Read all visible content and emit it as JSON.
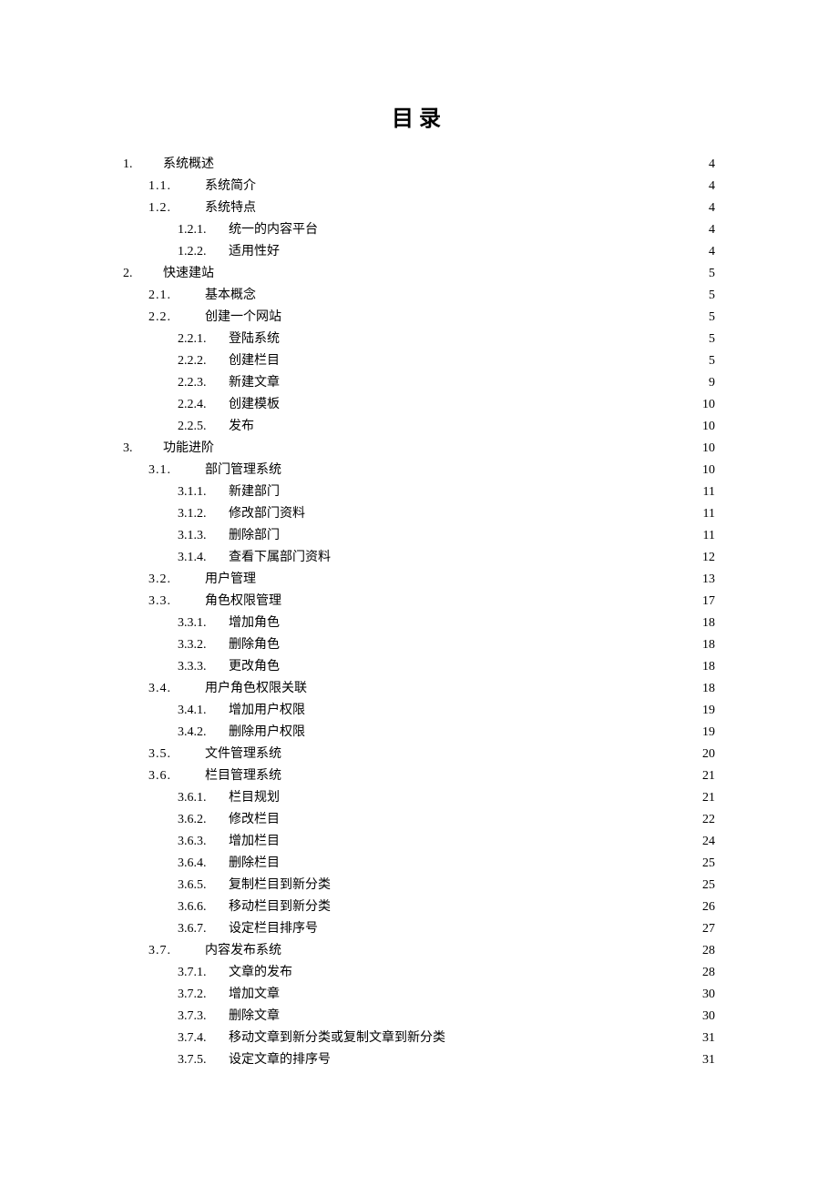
{
  "title": "目录",
  "entries": [
    {
      "level": 0,
      "num": "1.",
      "label": "系统概述",
      "page": "4"
    },
    {
      "level": 1,
      "num": "1.1.",
      "label": "系统简介",
      "page": "4"
    },
    {
      "level": 1,
      "num": "1.2.",
      "label": "系统特点",
      "page": "4"
    },
    {
      "level": 2,
      "num": "1.2.1.",
      "label": "统一的内容平台",
      "page": "4"
    },
    {
      "level": 2,
      "num": "1.2.2.",
      "label": "适用性好",
      "page": "4"
    },
    {
      "level": 0,
      "num": "2.",
      "label": "快速建站",
      "page": "5"
    },
    {
      "level": 1,
      "num": "2.1.",
      "label": "基本概念",
      "page": "5"
    },
    {
      "level": 1,
      "num": "2.2.",
      "label": "创建一个网站",
      "page": "5"
    },
    {
      "level": 2,
      "num": "2.2.1.",
      "label": "登陆系统",
      "page": "5"
    },
    {
      "level": 2,
      "num": "2.2.2.",
      "label": "创建栏目",
      "page": "5"
    },
    {
      "level": 2,
      "num": "2.2.3.",
      "label": "新建文章",
      "page": "9"
    },
    {
      "level": 2,
      "num": "2.2.4.",
      "label": "创建模板",
      "page": "10"
    },
    {
      "level": 2,
      "num": "2.2.5.",
      "label": "发布",
      "page": "10"
    },
    {
      "level": 0,
      "num": "3.",
      "label": "功能进阶",
      "page": "10"
    },
    {
      "level": 1,
      "num": "3.1.",
      "label": "部门管理系统",
      "page": "10"
    },
    {
      "level": 2,
      "num": "3.1.1.",
      "label": "新建部门",
      "page": "11"
    },
    {
      "level": 2,
      "num": "3.1.2.",
      "label": "修改部门资料",
      "page": "11"
    },
    {
      "level": 2,
      "num": "3.1.3.",
      "label": "删除部门",
      "page": "11"
    },
    {
      "level": 2,
      "num": "3.1.4.",
      "label": "查看下属部门资料",
      "page": "12"
    },
    {
      "level": 1,
      "num": "3.2.",
      "label": "用户管理",
      "page": "13"
    },
    {
      "level": 1,
      "num": "3.3.",
      "label": "角色权限管理",
      "page": "17"
    },
    {
      "level": 2,
      "num": "3.3.1.",
      "label": "增加角色",
      "page": "18"
    },
    {
      "level": 2,
      "num": "3.3.2.",
      "label": "删除角色",
      "page": "18"
    },
    {
      "level": 2,
      "num": "3.3.3.",
      "label": "更改角色",
      "page": "18"
    },
    {
      "level": 1,
      "num": "3.4.",
      "label": "用户角色权限关联",
      "page": "18"
    },
    {
      "level": 2,
      "num": "3.4.1.",
      "label": "增加用户权限",
      "page": "19"
    },
    {
      "level": 2,
      "num": "3.4.2.",
      "label": "删除用户权限",
      "page": "19"
    },
    {
      "level": 1,
      "num": "3.5.",
      "label": "文件管理系统",
      "page": "20"
    },
    {
      "level": 1,
      "num": "3.6.",
      "label": "栏目管理系统",
      "page": "21"
    },
    {
      "level": 2,
      "num": "3.6.1.",
      "label": "栏目规划",
      "page": "21"
    },
    {
      "level": 2,
      "num": "3.6.2.",
      "label": "修改栏目",
      "page": "22"
    },
    {
      "level": 2,
      "num": "3.6.3.",
      "label": "增加栏目",
      "page": "24"
    },
    {
      "level": 2,
      "num": "3.6.4.",
      "label": "删除栏目",
      "page": "25"
    },
    {
      "level": 2,
      "num": "3.6.5.",
      "label": "复制栏目到新分类",
      "page": "25"
    },
    {
      "level": 2,
      "num": "3.6.6.",
      "label": "移动栏目到新分类",
      "page": "26"
    },
    {
      "level": 2,
      "num": "3.6.7.",
      "label": "设定栏目排序号",
      "page": "27"
    },
    {
      "level": 1,
      "num": "3.7.",
      "label": "内容发布系统",
      "page": "28"
    },
    {
      "level": 2,
      "num": "3.7.1.",
      "label": "文章的发布",
      "page": "28"
    },
    {
      "level": 2,
      "num": "3.7.2.",
      "label": "增加文章",
      "page": "30"
    },
    {
      "level": 2,
      "num": "3.7.3.",
      "label": "删除文章",
      "page": "30"
    },
    {
      "level": 2,
      "num": "3.7.4.",
      "label": "移动文章到新分类或复制文章到新分类",
      "page": "31"
    },
    {
      "level": 2,
      "num": "3.7.5.",
      "label": "设定文章的排序号",
      "page": "31"
    }
  ]
}
